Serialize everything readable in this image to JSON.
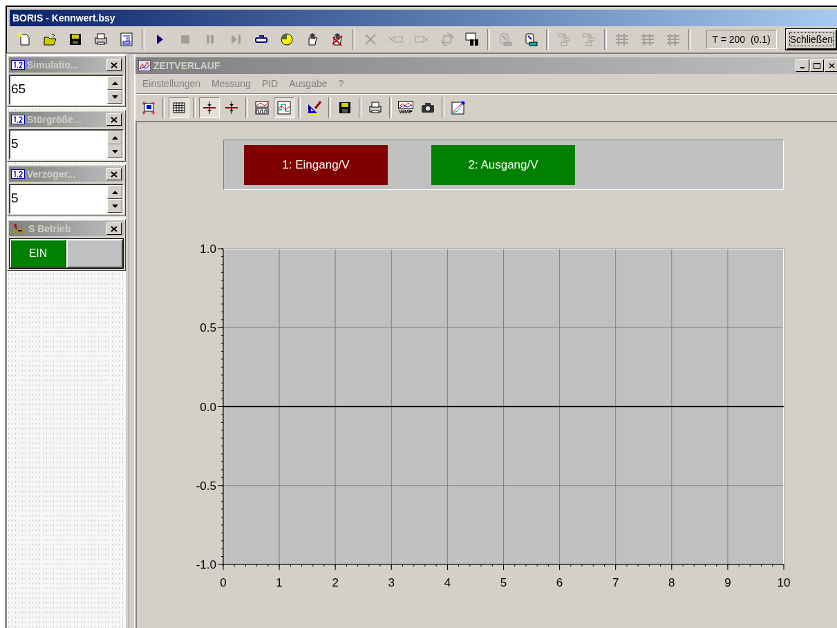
{
  "window": {
    "title": "BORIS - Kennwert.bsy"
  },
  "toolbar": [
    {
      "kind": "new",
      "disabled": false
    },
    {
      "kind": "open",
      "disabled": false
    },
    {
      "kind": "save",
      "disabled": false
    },
    {
      "kind": "print",
      "disabled": false
    },
    {
      "kind": "report",
      "disabled": false
    },
    {
      "kind": "sep"
    },
    {
      "kind": "play",
      "disabled": false
    },
    {
      "kind": "stop",
      "disabled": true
    },
    {
      "kind": "pause",
      "disabled": true
    },
    {
      "kind": "step",
      "disabled": true
    },
    {
      "kind": "loop",
      "disabled": false
    },
    {
      "kind": "clock",
      "disabled": false
    },
    {
      "kind": "hand",
      "disabled": false
    },
    {
      "kind": "handx",
      "disabled": false
    },
    {
      "kind": "sep"
    },
    {
      "kind": "cross",
      "disabled": true
    },
    {
      "kind": "blockin",
      "disabled": true
    },
    {
      "kind": "blockout",
      "disabled": true
    },
    {
      "kind": "cycle",
      "disabled": true
    },
    {
      "kind": "binoculars",
      "disabled": false
    },
    {
      "kind": "sep"
    },
    {
      "kind": "clip",
      "disabled": true
    },
    {
      "kind": "clip",
      "disabled": false
    },
    {
      "kind": "sep"
    },
    {
      "kind": "tree",
      "disabled": true
    },
    {
      "kind": "tree",
      "disabled": true
    },
    {
      "kind": "sep"
    },
    {
      "kind": "bus",
      "disabled": true
    },
    {
      "kind": "bus",
      "disabled": true
    },
    {
      "kind": "bus",
      "disabled": true
    }
  ],
  "time_display": "T = 200  (0.1)",
  "close_button": "Schließen",
  "panels": [
    {
      "kind": "spin",
      "title": "Simulatio...",
      "value": "65"
    },
    {
      "kind": "spin",
      "title": "Störgröße...",
      "value": "5"
    },
    {
      "kind": "spin",
      "title": "Verzöger...",
      "value": "5"
    },
    {
      "kind": "switch",
      "title": "S Betrieb",
      "label": "EIN",
      "on": true
    }
  ],
  "plot_window": {
    "title": "ZEITVERLAUF",
    "menu": [
      "Einstellungen",
      "Messung",
      "PID",
      "Ausgabe",
      "?"
    ],
    "toolbar": [
      {
        "kind": "frame",
        "pressed": false
      },
      {
        "kind": "sep"
      },
      {
        "kind": "grid",
        "pressed": true
      },
      {
        "kind": "sep"
      },
      {
        "kind": "cursor",
        "pressed": true
      },
      {
        "kind": "cursor",
        "pressed": false
      },
      {
        "kind": "sep"
      },
      {
        "kind": "signal",
        "pressed": false
      },
      {
        "kind": "wave",
        "pressed": true
      },
      {
        "kind": "sep"
      },
      {
        "kind": "triangle",
        "pressed": false
      },
      {
        "kind": "sep"
      },
      {
        "kind": "save",
        "pressed": false
      },
      {
        "kind": "sep"
      },
      {
        "kind": "print",
        "pressed": false
      },
      {
        "kind": "sep"
      },
      {
        "kind": "wmf",
        "pressed": false,
        "label": "WMF"
      },
      {
        "kind": "camera",
        "pressed": false
      },
      {
        "kind": "sep"
      },
      {
        "kind": "chartedit",
        "pressed": false
      }
    ],
    "legend": [
      {
        "label": "1: Eingang/V",
        "color": "#800000"
      },
      {
        "label": "2: Ausgang/V",
        "color": "#008000"
      }
    ],
    "chart_data": {
      "type": "line",
      "grid": true,
      "xlim": [
        0,
        10
      ],
      "ylim": [
        -1,
        1
      ],
      "xticks": [
        0,
        1,
        2,
        3,
        4,
        5,
        6,
        7,
        8,
        9,
        10
      ],
      "yticks": [
        {
          "value": -1,
          "label": "-1.0"
        },
        {
          "value": -0.5,
          "label": "-0.5"
        },
        {
          "value": 0,
          "label": "0.0"
        },
        {
          "value": 0.5,
          "label": "0.5"
        },
        {
          "value": 1,
          "label": "1.0"
        }
      ]
    }
  }
}
